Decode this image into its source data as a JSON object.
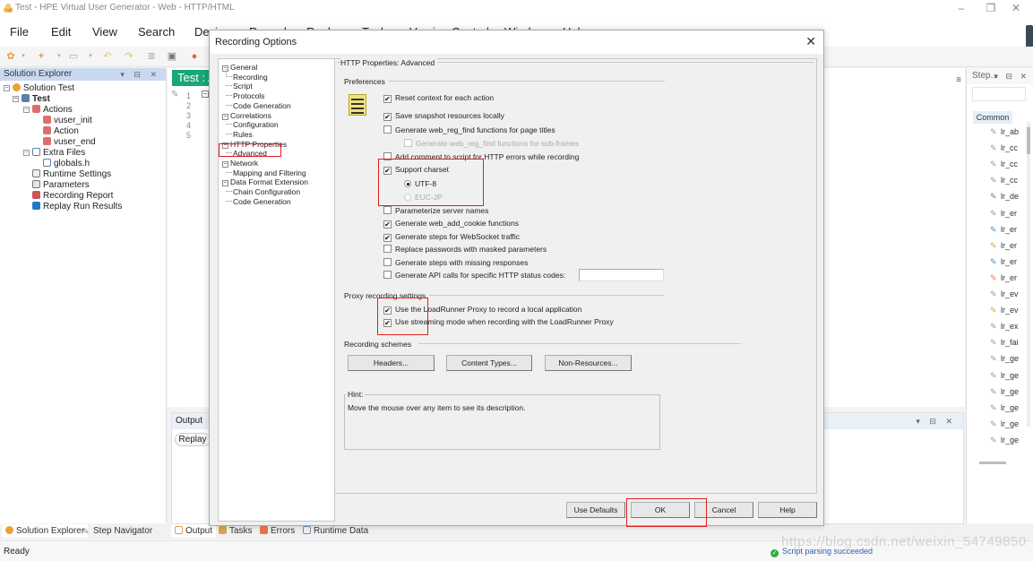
{
  "window": {
    "title": "Test - HPE Virtual User Generator - Web - HTTP/HTML",
    "controls": {
      "minimize": "–",
      "maximize": "❐",
      "close": "✕"
    }
  },
  "menu": [
    "File",
    "Edit",
    "View",
    "Search",
    "Design",
    "Record",
    "Replay",
    "Tools",
    "Version Control",
    "Window",
    "Help"
  ],
  "toolbar": {
    "icons": [
      "solution-icon",
      "dropdown-icon",
      "new-script-icon",
      "dropdown-icon",
      "save-icon",
      "dropdown-icon",
      "undo-icon",
      "redo-icon",
      "compile-icon",
      "runtime-settings-icon",
      "record-icon"
    ]
  },
  "solution_explorer": {
    "title": "Solution Explorer",
    "header_controls": "▾ ⊟ ✕",
    "tree": [
      {
        "label": "Solution Test",
        "level": 0,
        "expander": "−",
        "icon": "solution-icon"
      },
      {
        "label": "Test",
        "level": 1,
        "expander": "−",
        "icon": "script-icon",
        "bold": true
      },
      {
        "label": "Actions",
        "level": 2,
        "expander": "−",
        "icon": "actions-icon"
      },
      {
        "label": "vuser_init",
        "level": 3,
        "icon": "action-icon"
      },
      {
        "label": "Action",
        "level": 3,
        "icon": "action-icon"
      },
      {
        "label": "vuser_end",
        "level": 3,
        "icon": "action-icon"
      },
      {
        "label": "Extra Files",
        "level": 2,
        "expander": "−",
        "icon": "folder-icon"
      },
      {
        "label": "globals.h",
        "level": 3,
        "icon": "file-icon"
      },
      {
        "label": "Runtime Settings",
        "level": 2,
        "icon": "settings-icon"
      },
      {
        "label": "Parameters",
        "level": 2,
        "icon": "parameters-icon"
      },
      {
        "label": "Recording Report",
        "level": 2,
        "icon": "report-icon"
      },
      {
        "label": "Replay Run Results",
        "level": 2,
        "icon": "results-icon"
      }
    ]
  },
  "editor": {
    "tab_label": "Test : A",
    "line_numbers": [
      "1",
      "2",
      "3",
      "4",
      "5"
    ]
  },
  "output_panel": {
    "title": "Output",
    "header_controls": "▾ ⊟ ✕",
    "filter_button": "Replay"
  },
  "step_toolbox": {
    "title": "Step...",
    "header_controls": "▾ ⊟ ✕",
    "category": "Common",
    "items": [
      "lr_ab",
      "lr_cc",
      "lr_cc",
      "lr_cc",
      "lr_de",
      "lr_er",
      "lr_er",
      "lr_er",
      "lr_er",
      "lr_er",
      "lr_ev",
      "lr_ev",
      "lr_ex",
      "lr_fai",
      "lr_ge",
      "lr_ge",
      "lr_ge",
      "lr_ge",
      "lr_ge",
      "lr_ge"
    ]
  },
  "bottom_tabs": {
    "left": [
      "Solution Explorer",
      "Step Navigator"
    ],
    "right": [
      "Output",
      "Tasks",
      "Errors",
      "Runtime Data"
    ]
  },
  "status": {
    "ready": "Ready",
    "parse": "Script parsing succeeded",
    "watermark": "https://blog.csdn.net/weixin_54749850"
  },
  "dialog": {
    "title": "Recording Options",
    "close": "✕",
    "nav": [
      {
        "label": "General",
        "type": "parent"
      },
      {
        "label": "Recording",
        "type": "child"
      },
      {
        "label": "Script",
        "type": "child"
      },
      {
        "label": "Protocols",
        "type": "child"
      },
      {
        "label": "Code Generation",
        "type": "child"
      },
      {
        "label": "Correlations",
        "type": "parent"
      },
      {
        "label": "Configuration",
        "type": "child"
      },
      {
        "label": "Rules",
        "type": "child"
      },
      {
        "label": "HTTP Properties",
        "type": "parent"
      },
      {
        "label": "Advanced",
        "type": "child",
        "selected": true
      },
      {
        "label": "Network",
        "type": "parent"
      },
      {
        "label": "Mapping and Filtering",
        "type": "child"
      },
      {
        "label": "Data Format Extension",
        "type": "parent"
      },
      {
        "label": "Chain Configuration",
        "type": "child"
      },
      {
        "label": "Code Generation",
        "type": "child"
      }
    ],
    "section_title": "HTTP Properties: Advanced",
    "preferences": {
      "title": "Preferences",
      "options": [
        {
          "label": "Reset context for each action",
          "checked": true
        },
        {
          "label": "Save snapshot resources locally",
          "checked": true
        },
        {
          "label": "Generate web_reg_find functions for page titles",
          "checked": false
        },
        {
          "label": "Generate web_reg_find functions for sub-frames",
          "checked": false,
          "disabled": true
        },
        {
          "label": "Add comment to script for HTTP errors while recording",
          "checked": false
        },
        {
          "label": "Support charset",
          "checked": true
        },
        {
          "label": "Parameterize server names",
          "checked": false
        },
        {
          "label": "Generate web_add_cookie functions",
          "checked": true
        },
        {
          "label": "Generate steps for WebSocket traffic",
          "checked": true
        },
        {
          "label": "Replace passwords with masked parameters",
          "checked": false
        },
        {
          "label": "Generate steps with missing responses",
          "checked": false
        },
        {
          "label": "Generate API calls for specific HTTP status codes:",
          "checked": false
        }
      ],
      "charset_options": [
        {
          "label": "UTF-8",
          "selected": true
        },
        {
          "label": "EUC-JP",
          "selected": false,
          "disabled": true
        }
      ],
      "status_codes_value": ""
    },
    "proxy": {
      "title": "Proxy recording settings",
      "options": [
        {
          "label": "Use the LoadRunner Proxy to record a local application",
          "checked": true
        },
        {
          "label": "Use streaming mode when recording with the LoadRunner Proxy",
          "checked": true
        }
      ]
    },
    "schemes": {
      "title": "Recording schemes",
      "buttons": [
        "Headers...",
        "Content Types...",
        "Non-Resources..."
      ]
    },
    "hint": {
      "title": "Hint:",
      "text": "Move the mouse over any item to see its description."
    },
    "footer_buttons": [
      "Use Defaults",
      "OK",
      "Cancel",
      "Help"
    ],
    "highlight_color": "#e02020"
  }
}
